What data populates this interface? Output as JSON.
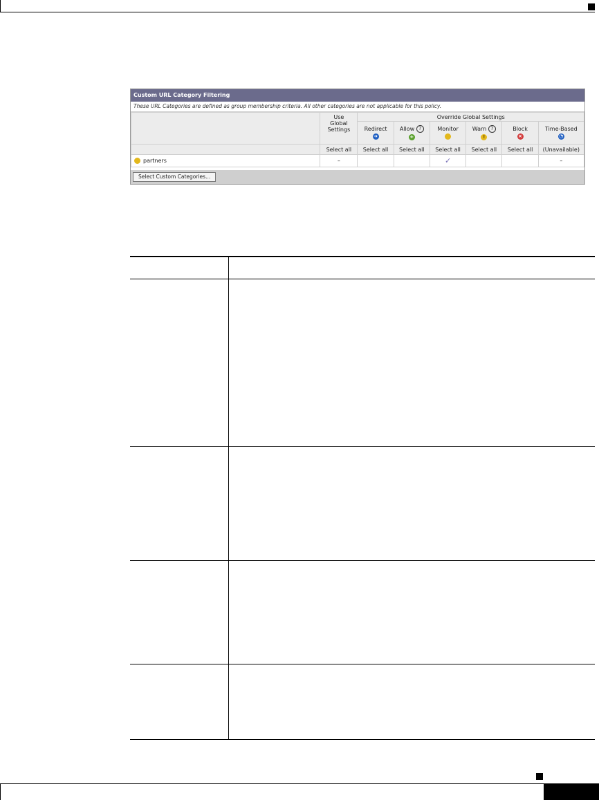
{
  "panel": {
    "title": "Custom URL Category Filtering",
    "note": "These URL Categories are defined as group membership criteria. All other categories are not applicable for this policy.",
    "use_global_label_1": "Use",
    "use_global_label_2": "Global",
    "use_global_label_3": "Settings",
    "override_group_label": "Override Global Settings",
    "columns": [
      {
        "label": "Redirect",
        "icon": "redirect-arrow-icon",
        "color": "#1f5fc2"
      },
      {
        "label": "Allow",
        "icon": "allow-plus-icon",
        "color": "#5aa02c"
      },
      {
        "label": "Monitor",
        "icon": "monitor-circle-icon",
        "color": "#e3b81c"
      },
      {
        "label": "Warn",
        "icon": "warn-exclamation-icon",
        "color": "#e3b81c"
      },
      {
        "label": "Block",
        "icon": "block-x-icon",
        "color": "#d23b3b"
      },
      {
        "label": "Time-Based",
        "icon": "time-based-clock-icon",
        "color": "#1f5fc2"
      }
    ],
    "select_all": "Select all",
    "unavailable": "(Unavailable)",
    "row": {
      "name": "partners",
      "use_global": "–",
      "monitor": "✓",
      "time_based": "–"
    },
    "button_label": "Select Custom Categories..."
  }
}
